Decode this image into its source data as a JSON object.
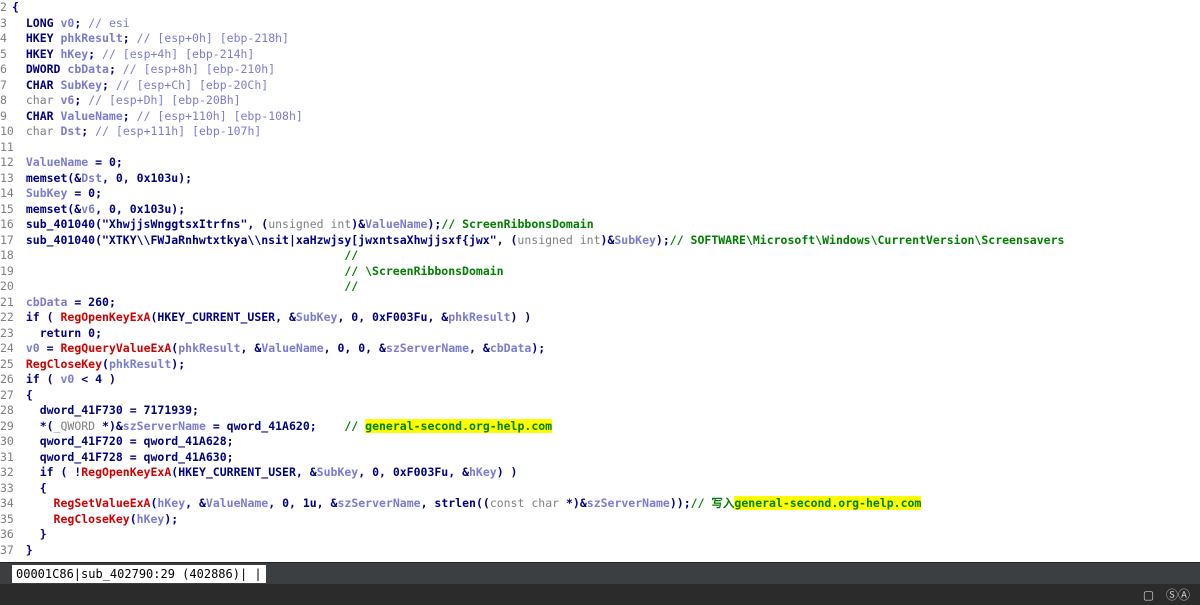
{
  "code": {
    "top_partial": "j       _       _",
    "lines": [
      {
        "n": "2",
        "text": "{"
      },
      {
        "n": "3",
        "text": "  LONG v0; // esi"
      },
      {
        "n": "4",
        "text": "  HKEY phkResult; // [esp+0h] [ebp-218h]"
      },
      {
        "n": "5",
        "text": "  HKEY hKey; // [esp+4h] [ebp-214h]"
      },
      {
        "n": "6",
        "text": "  DWORD cbData; // [esp+8h] [ebp-210h]"
      },
      {
        "n": "7",
        "text": "  CHAR SubKey; // [esp+Ch] [ebp-20Ch]"
      },
      {
        "n": "8",
        "text": "  char v6; // [esp+Dh] [ebp-20Bh]"
      },
      {
        "n": "9",
        "text": "  CHAR ValueName; // [esp+110h] [ebp-108h]"
      },
      {
        "n": "10",
        "text": "  char Dst; // [esp+111h] [ebp-107h]"
      },
      {
        "n": "11",
        "text": ""
      },
      {
        "n": "12",
        "text": "  ValueName = 0;"
      },
      {
        "n": "13",
        "text": "  memset(&Dst, 0, 0x103u);"
      },
      {
        "n": "14",
        "text": "  SubKey = 0;"
      },
      {
        "n": "15",
        "text": "  memset(&v6, 0, 0x103u);"
      },
      {
        "n": "16",
        "text": "  sub_401040(\"XhwjjsWnggtsxItrfns\", (unsigned int)&ValueName);// ScreenRibbonsDomain"
      },
      {
        "n": "17",
        "text": "  sub_401040(\"XTKY\\\\FWJaRnhwtxtkya\\\\nsit|xaHzwjsy[jwxntsaXhwjjsxf{jwx\", (unsigned int)&SubKey);// SOFTWARE\\Microsoft\\Windows\\CurrentVersion\\Screensavers"
      },
      {
        "n": "18",
        "text": "                                                //"
      },
      {
        "n": "19",
        "text": "                                                // \\ScreenRibbonsDomain"
      },
      {
        "n": "20",
        "text": "                                                //"
      },
      {
        "n": "21",
        "text": "  cbData = 260;"
      },
      {
        "n": "22",
        "text": "  if ( RegOpenKeyExA(HKEY_CURRENT_USER, &SubKey, 0, 0xF003Fu, &phkResult) )"
      },
      {
        "n": "23",
        "text": "    return 0;"
      },
      {
        "n": "24",
        "text": "  v0 = RegQueryValueExA(phkResult, &ValueName, 0, 0, &szServerName, &cbData);"
      },
      {
        "n": "25",
        "text": "  RegCloseKey(phkResult);"
      },
      {
        "n": "26",
        "text": "  if ( v0 < 4 )"
      },
      {
        "n": "27",
        "text": "  {"
      },
      {
        "n": "28",
        "text": "    dword_41F730 = 7171939;"
      },
      {
        "n": "29",
        "text": "    *(_QWORD *)&szServerName = qword_41A620;    // general-second.org-help.com"
      },
      {
        "n": "30",
        "text": "    qword_41F720 = qword_41A628;"
      },
      {
        "n": "31",
        "text": "    qword_41F728 = qword_41A630;"
      },
      {
        "n": "32",
        "text": "    if ( !RegOpenKeyExA(HKEY_CURRENT_USER, &SubKey, 0, 0xF003Fu, &hKey) )"
      },
      {
        "n": "33",
        "text": "    {"
      },
      {
        "n": "34",
        "text": "      RegSetValueExA(hKey, &ValueName, 0, 1u, &szServerName, strlen((const char *)&szServerName));// 写入general-second.org-help.com"
      },
      {
        "n": "35",
        "text": "      RegCloseKey(hKey);"
      },
      {
        "n": "36",
        "text": "    }"
      },
      {
        "n": "37",
        "text": "  }"
      }
    ]
  },
  "status": {
    "text": "00001C86|sub_402790:29 (402886)| |"
  },
  "tray": {
    "icon1": "window-icon",
    "text": "ⓈⒶ"
  },
  "colors": {
    "keyword": "#000080",
    "comment": "#008000",
    "variable": "#7b7bd0",
    "function": "#d00000",
    "highlight": "#ffff00"
  }
}
